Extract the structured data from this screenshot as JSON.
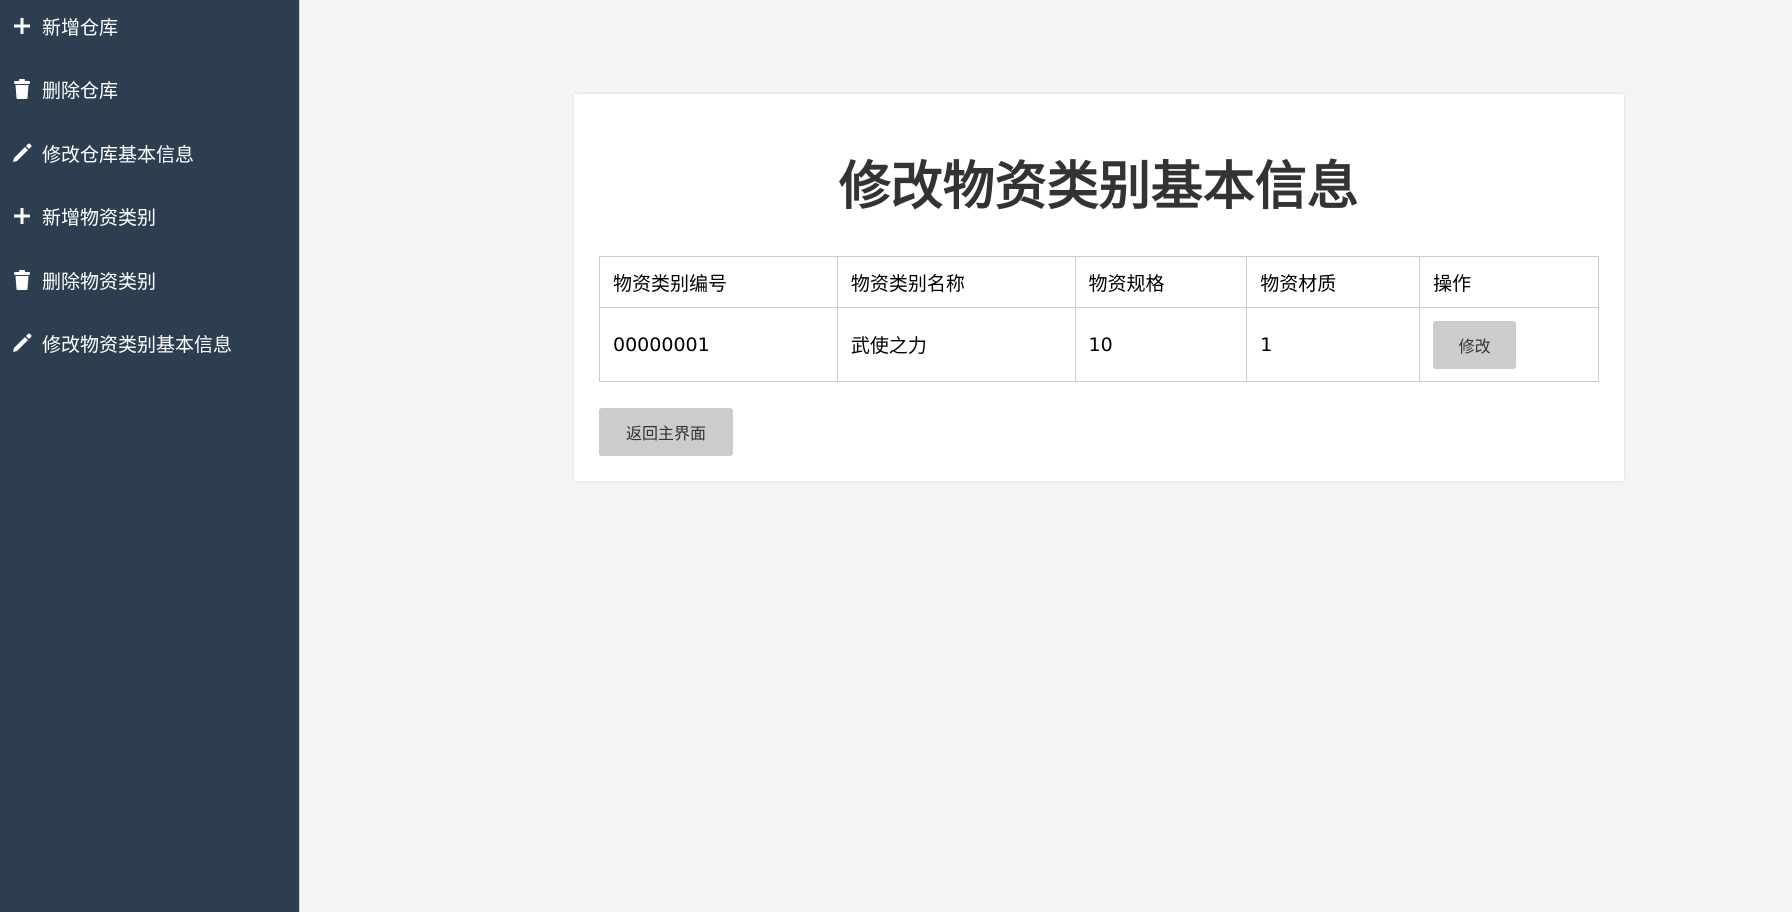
{
  "sidebar": {
    "items": [
      {
        "label": "新增仓库",
        "icon": "plus-icon"
      },
      {
        "label": "删除仓库",
        "icon": "trash-icon"
      },
      {
        "label": "修改仓库基本信息",
        "icon": "pencil-icon"
      },
      {
        "label": "新增物资类别",
        "icon": "plus-icon"
      },
      {
        "label": "删除物资类别",
        "icon": "trash-icon"
      },
      {
        "label": "修改物资类别基本信息",
        "icon": "pencil-icon"
      }
    ]
  },
  "main": {
    "title": "修改物资类别基本信息",
    "table": {
      "headers": [
        "物资类别编号",
        "物资类别名称",
        "物资规格",
        "物资材质",
        "操作"
      ],
      "rows": [
        {
          "id": "00000001",
          "name": "武使之力",
          "spec": "10",
          "material": "1",
          "action_label": "修改"
        }
      ]
    },
    "back_button_label": "返回主界面"
  },
  "colors": {
    "sidebar_bg": "#2d3e50",
    "page_bg": "#f4f4f4",
    "button_bg": "#cccccc",
    "title_color": "#333333"
  }
}
